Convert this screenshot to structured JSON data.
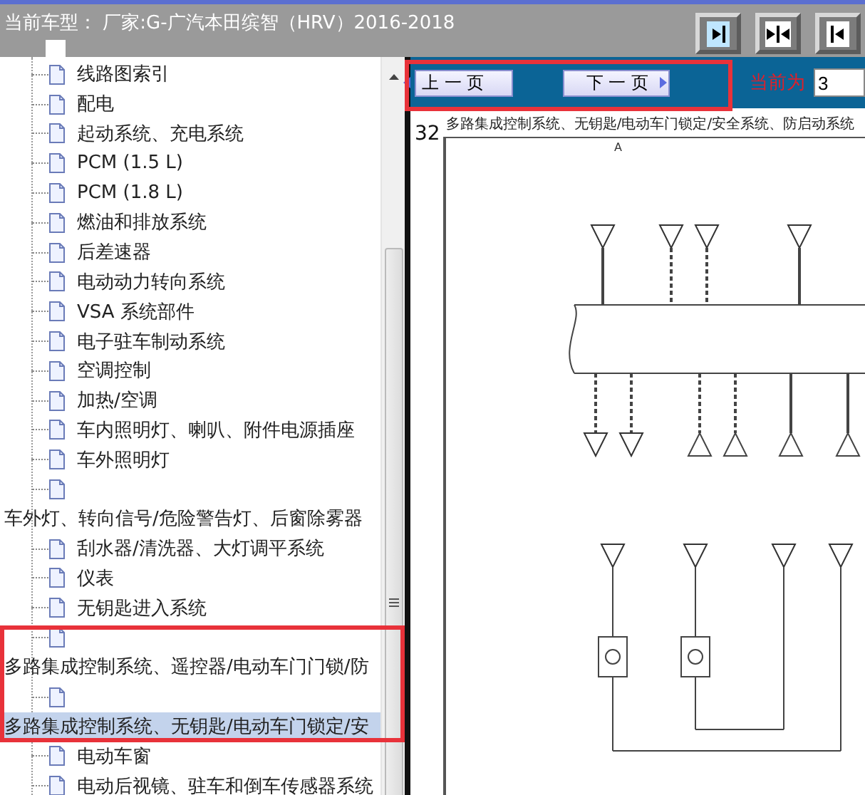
{
  "header": {
    "model_label": "当前车型： 厂家:G-广汽本田缤智（HRV）2016-2018"
  },
  "tree": {
    "items": [
      {
        "kind": "leaf",
        "label": "线路图索引",
        "selected": false
      },
      {
        "kind": "leaf",
        "label": "配电",
        "selected": false
      },
      {
        "kind": "leaf",
        "label": "起动系统、充电系统",
        "selected": false
      },
      {
        "kind": "leaf",
        "label": "PCM (1.5 L)",
        "selected": false
      },
      {
        "kind": "leaf",
        "label": "PCM (1.8 L)",
        "selected": false
      },
      {
        "kind": "leaf",
        "label": "燃油和排放系统",
        "selected": false
      },
      {
        "kind": "leaf",
        "label": "后差速器",
        "selected": false
      },
      {
        "kind": "leaf",
        "label": "电动动力转向系统",
        "selected": false
      },
      {
        "kind": "leaf",
        "label": "VSA 系统部件",
        "selected": false
      },
      {
        "kind": "leaf",
        "label": "电子驻车制动系统",
        "selected": false
      },
      {
        "kind": "leaf",
        "label": "空调控制",
        "selected": false
      },
      {
        "kind": "leaf",
        "label": "加热/空调",
        "selected": false
      },
      {
        "kind": "leaf",
        "label": "车内照明灯、喇叭、附件电源插座",
        "selected": false
      },
      {
        "kind": "leaf",
        "label": "车外照明灯",
        "selected": false
      },
      {
        "kind": "icon",
        "selected": false
      },
      {
        "kind": "text",
        "label": "车外灯、转向信号/危险警告灯、后窗除雾器",
        "selected": false
      },
      {
        "kind": "leaf",
        "label": "刮水器/清洗器、大灯调平系统",
        "selected": false
      },
      {
        "kind": "leaf",
        "label": "仪表",
        "selected": false
      },
      {
        "kind": "leaf",
        "label": "无钥匙进入系统",
        "selected": false
      },
      {
        "kind": "icon",
        "selected": false
      },
      {
        "kind": "text",
        "label": "多路集成控制系统、遥控器/电动车门门锁/防",
        "selected": false
      },
      {
        "kind": "icon",
        "selected": false
      },
      {
        "kind": "text",
        "label": "多路集成控制系统、无钥匙/电动车门锁定/安",
        "selected": true
      },
      {
        "kind": "leaf",
        "label": "电动车窗",
        "selected": false
      },
      {
        "kind": "leaf",
        "label": "电动后视镜、驻车和倒车传感器系统",
        "selected": false
      }
    ]
  },
  "nav": {
    "prev": "上 一 页",
    "next": "下 一 页",
    "current_label": "当前为",
    "current_value": "3"
  },
  "page": {
    "number": "32",
    "title": "多路集成控制系统、无钥匙/电动车门锁定/安全系统、防启动系统",
    "section": "A"
  }
}
